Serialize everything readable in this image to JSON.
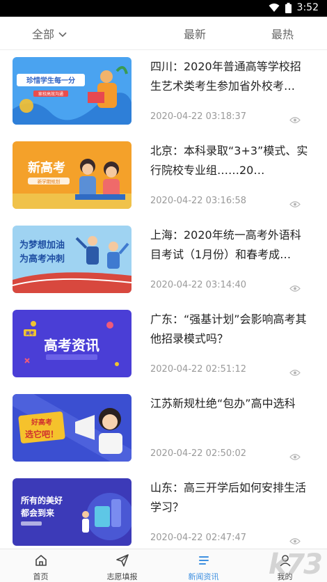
{
  "status_bar": {
    "time": "3:52"
  },
  "filter_bar": {
    "all_label": "全部",
    "latest_label": "最新",
    "hottest_label": "最热"
  },
  "news": [
    {
      "title": "四川：2020年普通高等学校招生艺术类考生参加省外校考…",
      "date": "2020-04-22 03:18:37",
      "thumb_text": "珍惜学生每一分",
      "thumb_sub": "家校高效沟通"
    },
    {
      "title": "北京：本科录取“3+3”模式、实行院校专业组……20…",
      "date": "2020-04-22 03:16:58",
      "thumb_text": "新高考",
      "thumb_sub": "新学期规划"
    },
    {
      "title": "上海：2020年统一高考外语科目考试（1月份）和春考成…",
      "date": "2020-04-22 03:14:40",
      "thumb_text": "为梦想加油",
      "thumb_sub": "为高考冲刺"
    },
    {
      "title": "广东：“强基计划”会影响高考其他招录模式吗？",
      "date": "2020-04-22 02:51:12",
      "thumb_text": "高考资讯",
      "thumb_sub": "高考"
    },
    {
      "title": "江苏新规杜绝“包办”高中选科",
      "date": "2020-04-22 02:50:02",
      "thumb_text": "好高考",
      "thumb_sub": "选它吧！"
    },
    {
      "title": "山东：高三开学后如何安排生活学习？",
      "date": "2020-04-22 02:47:47",
      "thumb_text": "所有的美好",
      "thumb_sub": "都会到来"
    }
  ],
  "tabbar": {
    "tabs": [
      {
        "label": "首页",
        "icon": "home-icon"
      },
      {
        "label": "志愿填报",
        "icon": "send-icon"
      },
      {
        "label": "新闻资讯",
        "icon": "news-icon"
      },
      {
        "label": "我的",
        "icon": "user-icon"
      }
    ]
  },
  "watermark": "k73",
  "colors": {
    "accent": "#3d8fe0",
    "status_bar": "#000000",
    "date_gray": "#9a9a9a"
  }
}
